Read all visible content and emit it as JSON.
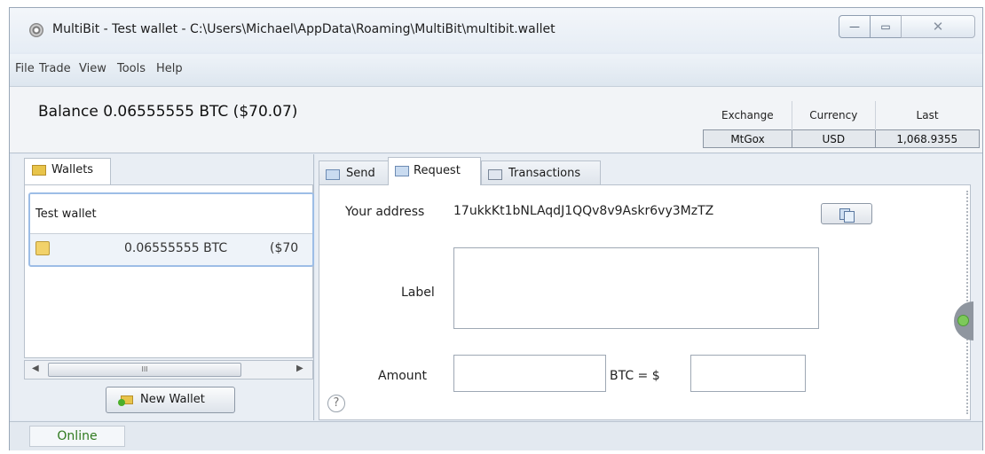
{
  "window": {
    "title": "MultiBit - Test wallet - C:\\Users\\Michael\\AppData\\Roaming\\MultiBit\\multibit.wallet",
    "controls": {
      "minimize": "—",
      "maximize": "▭",
      "close": "✕"
    }
  },
  "menu": [
    "File",
    "Trade",
    "View",
    "Tools",
    "Help"
  ],
  "balance": {
    "text": "Balance 0.06555555 BTC  ($70.07)"
  },
  "ticker": {
    "headers": [
      "Exchange",
      "Currency",
      "Last"
    ],
    "row": [
      "MtGox",
      "USD",
      "1,068.9355"
    ]
  },
  "wallets": {
    "tab_label": "Wallets",
    "items": [
      {
        "name": "Test wallet",
        "btc": "0.06555555 BTC",
        "usd": "($70"
      }
    ],
    "scroll_thumb": "III",
    "new_wallet_label": "New Wallet"
  },
  "tabs": [
    {
      "label": "Send"
    },
    {
      "label": "Request"
    },
    {
      "label": "Transactions"
    }
  ],
  "request": {
    "address_label": "Your address",
    "address": "17ukkKt1bNLAqdJ1QQv8v9Askr6vy3MzTZ",
    "label_label": "Label",
    "label_value": "",
    "amount_label": "Amount",
    "amount_btc": "",
    "btc_equals_text": "BTC  =  $",
    "amount_usd": "",
    "help_glyph": "?"
  },
  "status": {
    "text": "Online",
    "color": "#2f7a1f"
  }
}
